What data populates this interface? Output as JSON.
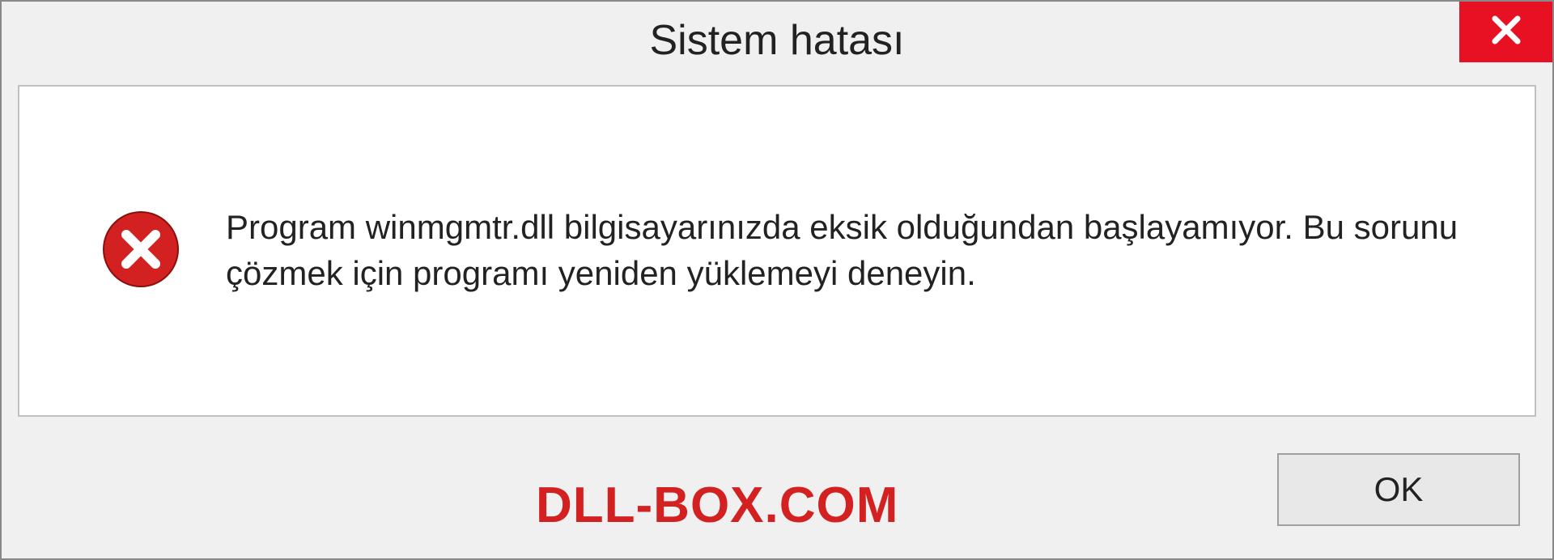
{
  "dialog": {
    "title": "Sistem hatası",
    "message": "Program winmgmtr.dll bilgisayarınızda eksik olduğundan başlayamıyor. Bu sorunu çözmek için programı yeniden yüklemeyi deneyin.",
    "ok_label": "OK"
  },
  "watermark": "DLL-BOX.COM",
  "colors": {
    "close_button": "#e81123",
    "error_icon": "#d32020",
    "watermark": "#d32020"
  }
}
